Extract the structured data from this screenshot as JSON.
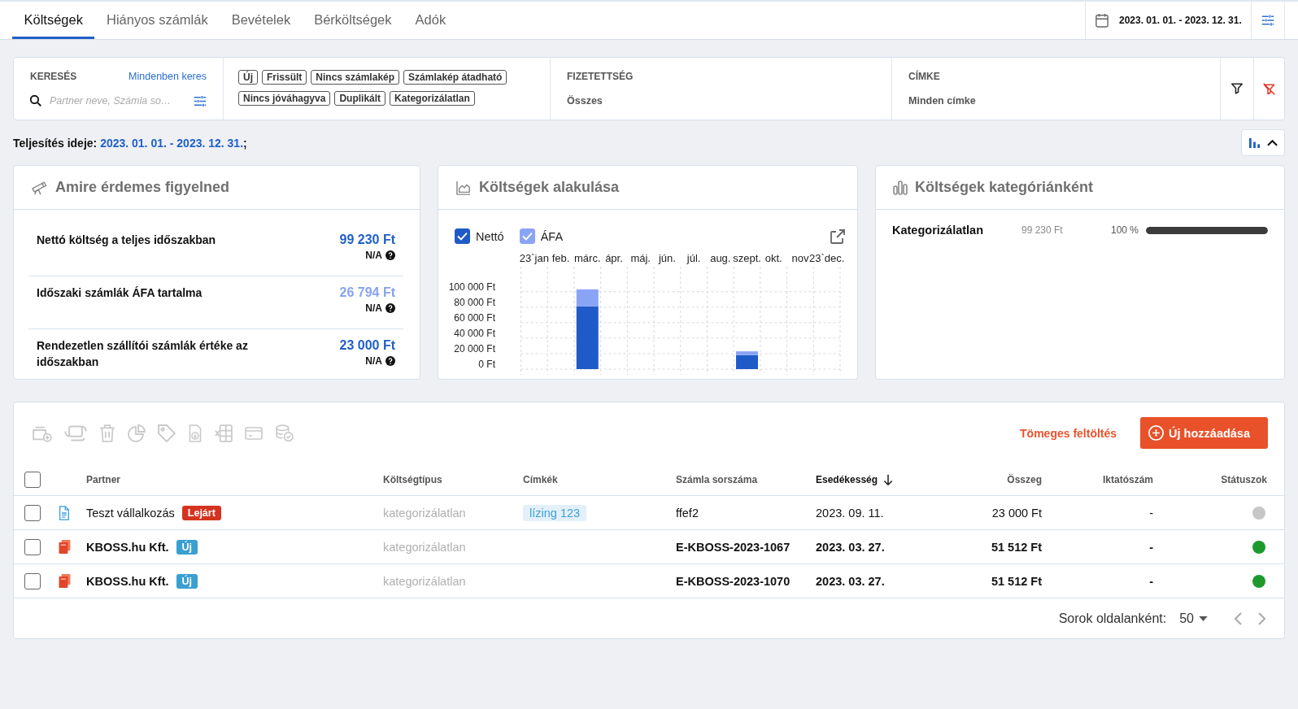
{
  "tabs": [
    {
      "label": "Költségek",
      "selected": true
    },
    {
      "label": "Hiányos számlák",
      "selected": false
    },
    {
      "label": "Bevételek",
      "selected": false
    },
    {
      "label": "Bérköltségek",
      "selected": false
    },
    {
      "label": "Adók",
      "selected": false
    }
  ],
  "date_range": "2023. 01. 01. - 2023. 12. 31.",
  "filters": {
    "search": {
      "label": "KERESÉS",
      "link": "Mindenben keres",
      "placeholder": "Partner neve, Számla so…"
    },
    "chips": [
      "Új",
      "Frissült",
      "Nincs számlakép",
      "Számlakép átadható",
      "Nincs jóváhagyva",
      "Duplikált",
      "Kategorizálatlan"
    ],
    "payment": {
      "label": "FIZETETTSÉG",
      "value": "Összes"
    },
    "tag": {
      "label": "CÍMKE",
      "value": "Minden címke"
    }
  },
  "period": {
    "label": "Teljesítés ideje:",
    "value": "2023. 01. 01. - 2023. 12. 31.",
    "suffix": ";"
  },
  "charts_expanded": true,
  "highlights": {
    "title": "Amire érdemes figyelned",
    "items": [
      {
        "label": "Nettó költség a teljes időszakban",
        "value": "99 230 Ft",
        "color": "#1f5fc9",
        "note": "N/A"
      },
      {
        "label": "Időszaki számlák ÁFA tartalma",
        "value": "26 794 Ft",
        "color": "#86a3f2",
        "note": "N/A"
      },
      {
        "label": "Rendezetlen szállítói számlák értéke az időszakban",
        "value": "23 000 Ft",
        "color": "#1f5fc9",
        "note": "N/A"
      }
    ]
  },
  "trend": {
    "title": "Költségek alakulása",
    "legend": [
      {
        "checked": true
      },
      {
        "checked": true
      }
    ],
    "chart_data": {
      "type": "bar",
      "stacked": true,
      "grid": true,
      "categories": [
        "23`jan",
        "feb.",
        "márc.",
        "ápr.",
        "máj.",
        "jún.",
        "júl.",
        "aug.",
        "szept.",
        "okt.",
        "nov",
        "23`dec."
      ],
      "series": [
        {
          "name": "Nettó",
          "color": "#1f5bc8",
          "values": [
            0,
            0,
            81000,
            0,
            0,
            0,
            0,
            0,
            18000,
            0,
            0,
            0
          ]
        },
        {
          "name": "ÁFA",
          "color": "#8aa4f5",
          "values": [
            0,
            0,
            22000,
            0,
            0,
            0,
            0,
            0,
            5000,
            0,
            0,
            0
          ]
        }
      ],
      "ylim": [
        0,
        105000
      ],
      "yticks": [
        {
          "value": 0,
          "label": "0 Ft"
        },
        {
          "value": 20000,
          "label": "20 000 Ft"
        },
        {
          "value": 40000,
          "label": "40 000 Ft"
        },
        {
          "value": 60000,
          "label": "60 000 Ft"
        },
        {
          "value": 80000,
          "label": "80 000 Ft"
        },
        {
          "value": 100000,
          "label": "100 000 Ft"
        }
      ]
    }
  },
  "categories": {
    "title": "Költségek kategóriánként",
    "items": [
      {
        "name": "Kategorizálatlan",
        "amount": "99 230 Ft",
        "percent": "100 %",
        "level": 1
      }
    ]
  },
  "table": {
    "toolbar_disabled": true,
    "bulk_upload": "Tömeges feltöltés",
    "add_button": "Új hozzáadása",
    "select_all": {
      "checked": false
    },
    "columns": [
      {
        "label": "Partner",
        "sorted": false
      },
      {
        "label": "Költségtípus",
        "sorted": false
      },
      {
        "label": "Címkék",
        "sorted": false
      },
      {
        "label": "Számla sorszáma",
        "sorted": false
      },
      {
        "label": "Esedékesség",
        "sorted": true
      },
      {
        "label": "Összeg",
        "sorted": false
      },
      {
        "label": "Iktatószám",
        "sorted": false
      },
      {
        "label": "Státuszok",
        "sorted": false
      }
    ],
    "rows": [
      {
        "checked": false,
        "file": {
          "kind": "document"
        },
        "unread": false,
        "partner": "Teszt vállalkozás",
        "badge": {
          "label": "Lejárt",
          "kind": "expired"
        },
        "cost_type": "kategorizálatlan",
        "tags": [
          "lízing 123"
        ],
        "invoice_number": "ffef2",
        "due": "2023. 09. 11.",
        "amount": "23 000 Ft",
        "filing_number": "-",
        "status": {
          "color": "#c6c6c6"
        }
      },
      {
        "checked": false,
        "file": {
          "kind": "pdf"
        },
        "unread": true,
        "partner": "KBOSS.hu Kft.",
        "badge": {
          "label": "Új",
          "kind": "new"
        },
        "cost_type": "kategorizálatlan",
        "invoice_number": "E-KBOSS-2023-1067",
        "due": "2023. 03. 27.",
        "amount": "51 512 Ft",
        "filing_number": "-",
        "status": {
          "color": "#1e9a2c"
        }
      },
      {
        "checked": false,
        "file": {
          "kind": "pdf"
        },
        "unread": true,
        "partner": "KBOSS.hu Kft.",
        "badge": {
          "label": "Új",
          "kind": "new"
        },
        "cost_type": "kategorizálatlan",
        "invoice_number": "E-KBOSS-2023-1070",
        "due": "2023. 03. 27.",
        "amount": "51 512 Ft",
        "filing_number": "-",
        "status": {
          "color": "#1e9a2c"
        }
      }
    ],
    "pagination": {
      "label": "Sorok oldalanként:",
      "value": "50"
    }
  }
}
